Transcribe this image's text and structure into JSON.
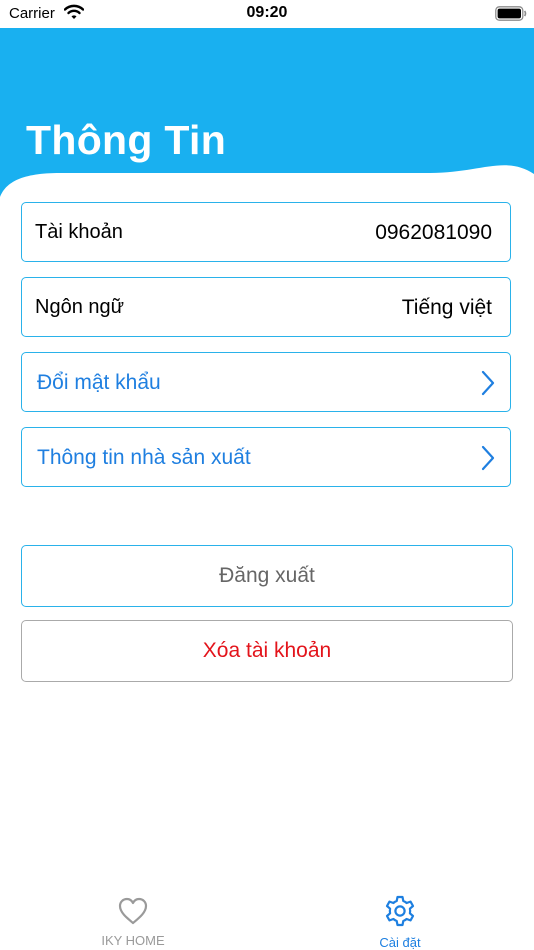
{
  "status_bar": {
    "carrier": "Carrier",
    "time": "09:20"
  },
  "header": {
    "title": "Thông Tin",
    "color": "#19b0f0"
  },
  "rows": {
    "account": {
      "label": "Tài khoản",
      "value": "0962081090"
    },
    "language": {
      "label": "Ngôn ngữ",
      "value": "Tiếng việt"
    },
    "change_password": {
      "label": "Đổi mật khẩu",
      "icon": "chevron-right-icon"
    },
    "manufacturer": {
      "label": "Thông tin nhà sản xuất",
      "icon": "chevron-right-icon"
    }
  },
  "buttons": {
    "logout": "Đăng xuất",
    "delete_account": "Xóa tài khoản"
  },
  "tabbar": {
    "items": [
      {
        "label": "IKY HOME",
        "icon": "heart-icon",
        "active": false
      },
      {
        "label": "Cài đặt",
        "icon": "gear-icon",
        "active": true
      }
    ]
  },
  "colors": {
    "accent": "#2ab2ea",
    "link": "#1f7fe0",
    "danger": "#e3141b"
  }
}
